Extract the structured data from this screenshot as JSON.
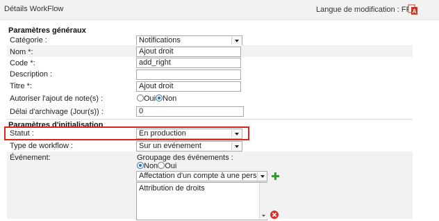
{
  "header": {
    "title": "Détails WorkFlow",
    "lang_label": "Langue de modification : FR"
  },
  "general": {
    "section_title": "Paramètres généraux",
    "categorie_label": "Catégorie :",
    "categorie_value": "Notifications",
    "nom_label": "Nom *:",
    "nom_value": "Ajout droit",
    "code_label": "Code *:",
    "code_value": "add_right",
    "description_label": "Description :",
    "description_value": "",
    "titre_label": "Titre *:",
    "titre_value": "Ajout droit",
    "notes_label": "Autoriser l'ajout de note(s) :",
    "notes_oui": "Oui",
    "notes_non": "Non",
    "notes_selected": "Non",
    "delai_label": "Délai d'archivage (Jour(s)) :",
    "delai_value": "0"
  },
  "init": {
    "section_title": "Paramètres d'initialisation",
    "statut_label": "Statut :",
    "statut_value": "En production",
    "type_label": "Type de workflow :",
    "type_value": "Sur un evénement",
    "evenement_label": "Événement:",
    "groupage_label": "Groupage des événements :",
    "groupage_non": "Non",
    "groupage_oui": "Oui",
    "groupage_selected": "Non",
    "event_select_value": "Affectation d'un compte à une personne",
    "event_list_item": "Attribution de droits"
  },
  "colors": {
    "highlight": "#e0231b",
    "add": "#2e9e2e",
    "remove": "#d9302a"
  }
}
